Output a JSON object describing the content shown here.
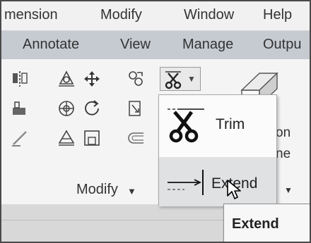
{
  "menu": [
    "mension",
    "Modify",
    "Window",
    "Help"
  ],
  "tabs": [
    "Annotate",
    "View",
    "Manage",
    "Outpu"
  ],
  "panel": {
    "title": "Modify",
    "title_chevron": "▼",
    "right_fragments": [
      "on",
      "ne"
    ]
  },
  "dropdown": {
    "items": [
      {
        "label": "Trim",
        "icon": "scissors-icon"
      },
      {
        "label": "Extend",
        "icon": "extend-icon"
      }
    ],
    "split_arrow": "▼",
    "side_arrow": "▼"
  },
  "tooltip": {
    "text": "Extend"
  },
  "colors": {
    "menubar_bg": "#f1f1f1",
    "tabbar_bg": "#c6cbd2",
    "panel_bg": "#f4f4f4",
    "hover_bg": "#dfe1e3",
    "tooltip_bg": "#f7f7f7"
  }
}
